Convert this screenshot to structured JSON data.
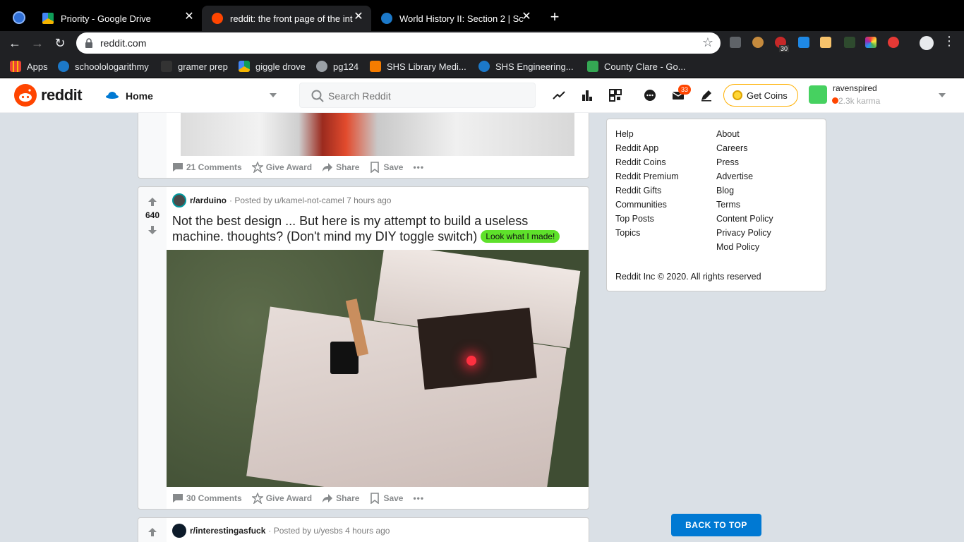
{
  "browser": {
    "tabs": [
      {
        "title": "Priority - Google Drive",
        "active": false
      },
      {
        "title": "reddit: the front page of the int",
        "active": true
      },
      {
        "title": "World History II: Section 2 | Sc",
        "active": false
      }
    ],
    "new_tab_label": "+",
    "close_label": "✕",
    "url": "reddit.com",
    "ext_badge": "30"
  },
  "bookmarks": [
    {
      "label": "Apps"
    },
    {
      "label": "schoolologarithmy"
    },
    {
      "label": "gramer prep"
    },
    {
      "label": "giggle drove"
    },
    {
      "label": "pg124"
    },
    {
      "label": "SHS Library Medi..."
    },
    {
      "label": "SHS Engineering..."
    },
    {
      "label": "County Clare - Go..."
    }
  ],
  "header": {
    "wordmark": "reddit",
    "home_label": "Home",
    "search_placeholder": "Search Reddit",
    "mail_badge": "33",
    "get_coins": "Get Coins",
    "username": "ravenspired",
    "karma": "2.3k karma"
  },
  "posts": [
    {
      "comments": "21 Comments",
      "award": "Give Award",
      "share": "Share",
      "save": "Save"
    },
    {
      "subreddit": "r/arduino",
      "posted_by": "· Posted by u/kamel-not-camel 7 hours ago",
      "votes": "640",
      "title": "Not the best design ... But here is my attempt to build a useless machine. thoughts? (Don't mind my DIY toggle switch)",
      "flair": "Look what I made!",
      "flair_color": "#5ee12b",
      "comments": "30 Comments",
      "award": "Give Award",
      "share": "Share",
      "save": "Save"
    },
    {
      "subreddit": "r/interestingasfuck",
      "posted_by": "· Posted by u/yesbs 4 hours ago"
    }
  ],
  "sidebar": {
    "col1": [
      "Help",
      "Reddit App",
      "Reddit Coins",
      "Reddit Premium",
      "Reddit Gifts",
      "Communities",
      "Top Posts",
      "Topics"
    ],
    "col2": [
      "About",
      "Careers",
      "Press",
      "Advertise",
      "Blog",
      "Terms",
      "Content Policy",
      "Privacy Policy",
      "Mod Policy"
    ],
    "copyright": "Reddit Inc © 2020. All rights reserved"
  },
  "back_to_top": "BACK TO TOP",
  "colors": {
    "reddit_orange": "#ff4500",
    "upvote_gray": "#878a8c",
    "blue": "#0079d3"
  }
}
